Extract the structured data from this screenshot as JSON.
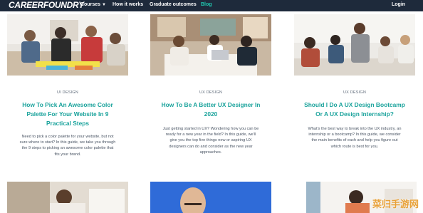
{
  "header": {
    "logo": "CAREERFOUNDRY",
    "nav": {
      "courses": "Courses",
      "how_it_works": "How it works",
      "graduate_outcomes": "Graduate outcomes",
      "blog": "Blog"
    },
    "login": "Login"
  },
  "cards": [
    {
      "category": "UI DESIGN",
      "title_line1": "How To Pick An Awesome Color",
      "title_line2": "Palette For Your Website In 9",
      "title_line3": "Practical Steps",
      "desc_line1": "Need to pick a color palette for your website, but not",
      "desc_line2": "sure where to start? In this guide, we take you through",
      "desc_line3": "the 9 steps to picking an awesome color palette that",
      "desc_line4": "fits your brand."
    },
    {
      "category": "UX DESIGN",
      "title_line1": "How To Be A Better UX Designer In",
      "title_line2": "2020",
      "desc_line1": "Just getting started in UX? Wondering how you can be",
      "desc_line2": "ready for a new year in the field? In this guide, we'll",
      "desc_line3": "give you the top five things new or aspiring UX",
      "desc_line4": "designers can do and consider as the new year",
      "desc_line5": "approaches."
    },
    {
      "category": "UX DESIGN",
      "title_line1": "Should I Do A UX Design Bootcamp",
      "title_line2": "Or A UX Design Internship?",
      "desc_line1": "What's the best way to break into the UX industry, an",
      "desc_line2": "internship or a bootcamp? In this guide, we consider",
      "desc_line3": "the main benefits of each and help you figure out",
      "desc_line4": "which route is best for you."
    }
  ],
  "watermark": "菜归手游网",
  "colors": {
    "navbar": "#1e2a3b",
    "accent": "#1ba39c",
    "blog_active": "#20c9b1"
  }
}
